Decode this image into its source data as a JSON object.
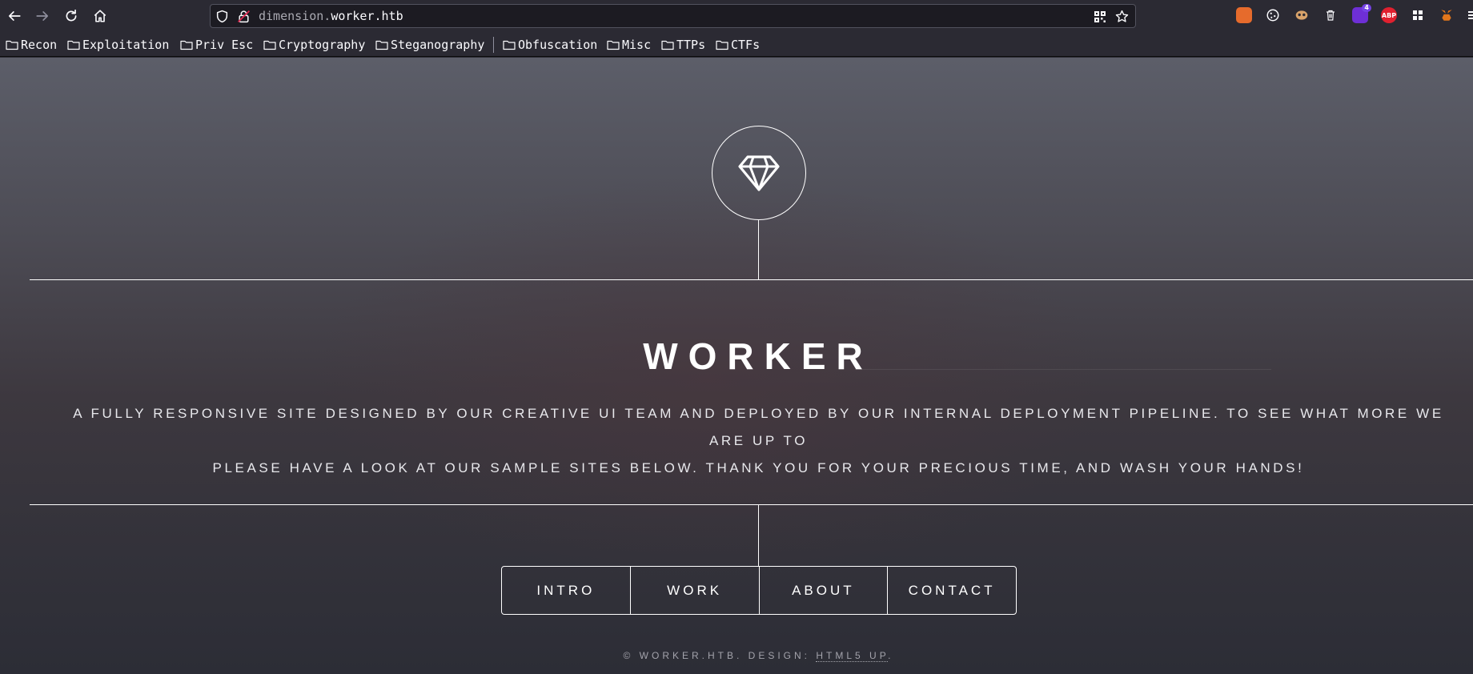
{
  "browser": {
    "url_prefix": "dimension.",
    "url_host": "worker.htb",
    "extensions": [
      {
        "name": "fox-extension-icon",
        "color": "#e66b2c",
        "label": ""
      },
      {
        "name": "cookie-icon",
        "color": "#3a3944",
        "label": ""
      },
      {
        "name": "mask-icon",
        "color": "#3a3944",
        "label": ""
      },
      {
        "name": "trash-icon",
        "color": "#3a3944",
        "label": ""
      },
      {
        "name": "dice-icon",
        "color": "#6e2fd6",
        "label": "",
        "badge": "4"
      },
      {
        "name": "adblock-icon",
        "color": "#e0202f",
        "label": "ABP"
      },
      {
        "name": "grid-extension-icon",
        "color": "#3a3944",
        "label": ""
      },
      {
        "name": "metamask-icon",
        "color": "#e2761b",
        "label": ""
      }
    ]
  },
  "bookmarks": [
    {
      "label": "Recon"
    },
    {
      "label": "Exploitation"
    },
    {
      "label": "Priv Esc"
    },
    {
      "label": "Cryptography"
    },
    {
      "label": "Steganography"
    },
    {
      "label": "Obfuscation"
    },
    {
      "label": "Misc"
    },
    {
      "label": "TTPs"
    },
    {
      "label": "CTFs"
    }
  ],
  "page": {
    "title": "WORKER",
    "subtitle_line1": "A FULLY RESPONSIVE SITE DESIGNED BY OUR CREATIVE UI TEAM AND DEPLOYED BY OUR INTERNAL DEPLOYMENT PIPELINE. TO SEE WHAT MORE WE ARE UP TO",
    "subtitle_line2": "PLEASE HAVE A LOOK AT OUR SAMPLE SITES BELOW. THANK YOU FOR YOUR PRECIOUS TIME, AND WASH YOUR HANDS!",
    "nav": [
      {
        "label": "INTRO"
      },
      {
        "label": "WORK"
      },
      {
        "label": "ABOUT"
      },
      {
        "label": "CONTACT"
      }
    ],
    "footer_prefix": "© WORKER.HTB. DESIGN: ",
    "footer_link": "HTML5 UP",
    "footer_suffix": "."
  }
}
